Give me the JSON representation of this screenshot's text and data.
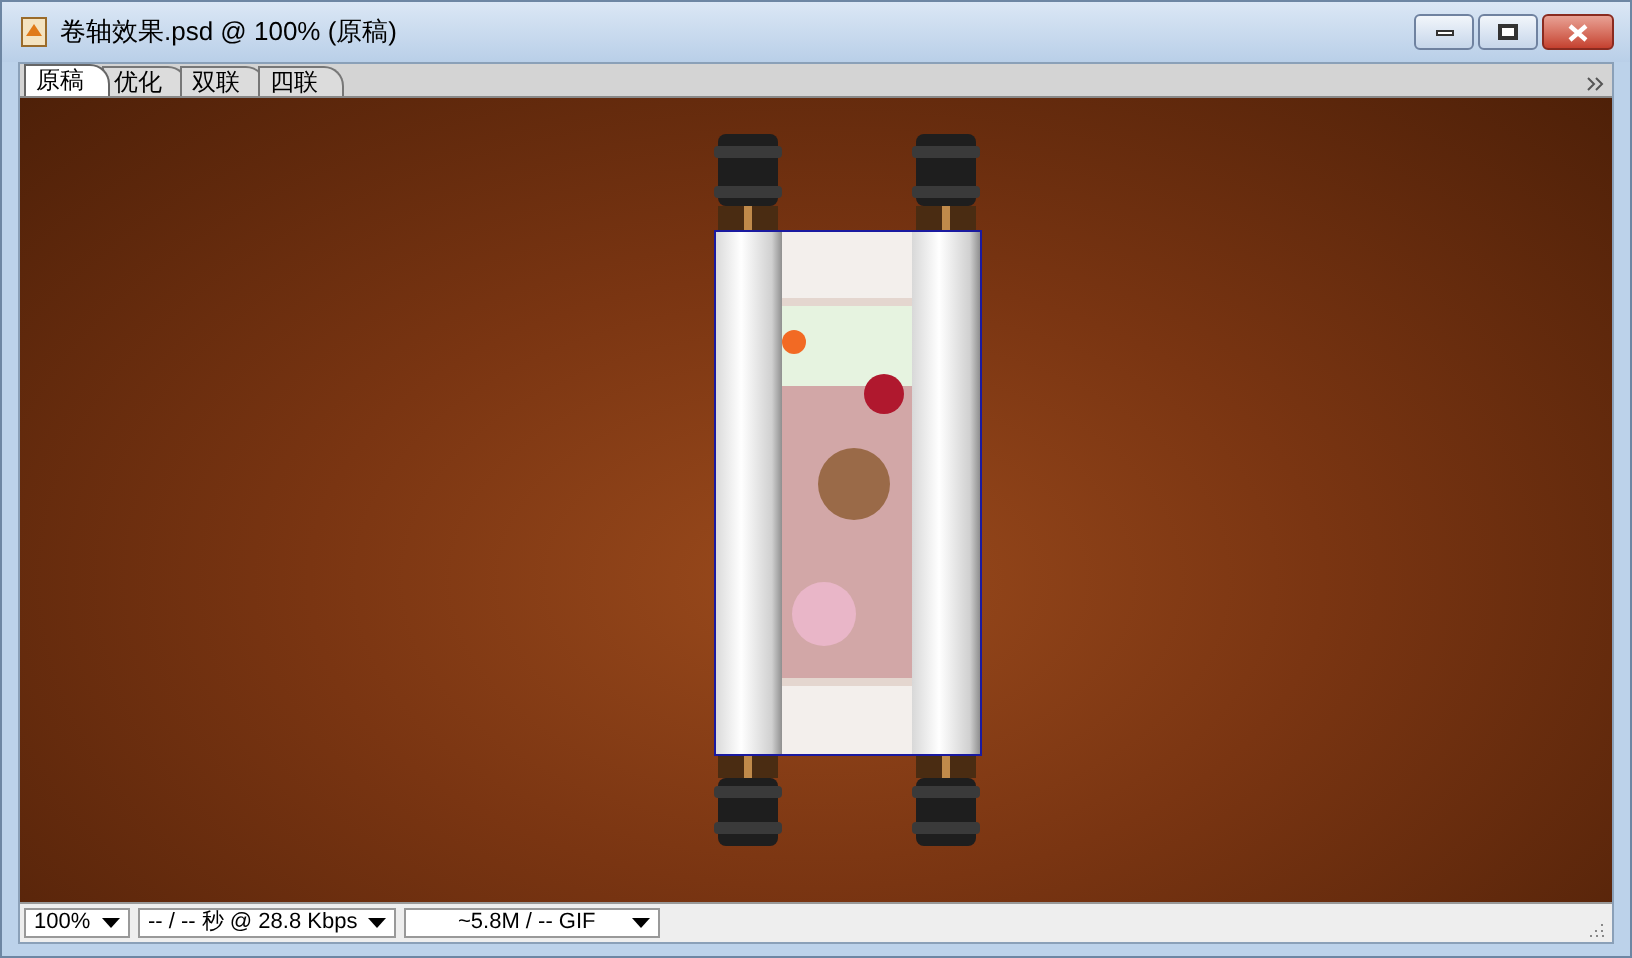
{
  "window": {
    "title": "卷轴效果.psd @ 100% (原稿)"
  },
  "tabs": [
    {
      "label": "原稿",
      "selected": true
    },
    {
      "label": "优化",
      "selected": false
    },
    {
      "label": "双联",
      "selected": false
    },
    {
      "label": "四联",
      "selected": false
    }
  ],
  "status_bar": {
    "zoom": "100%",
    "download_time": "-- / -- 秒 @ 28.8 Kbps",
    "file_size": "~5.8M / -- GIF"
  }
}
